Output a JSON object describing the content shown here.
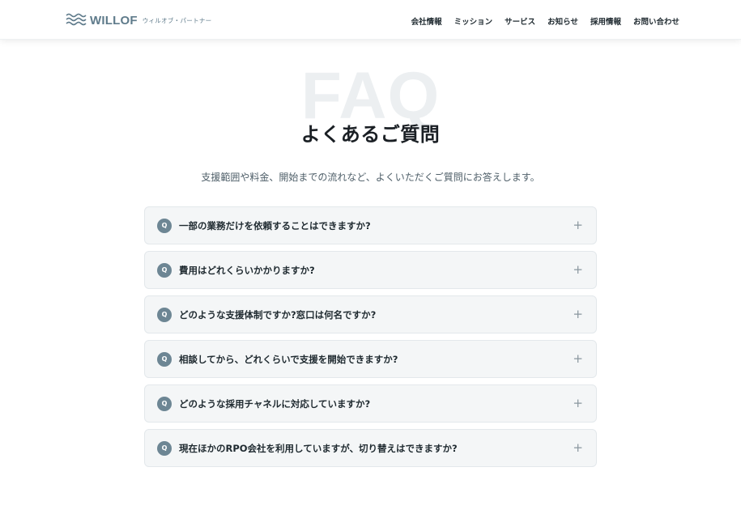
{
  "header": {
    "logo_name": "WILLOF",
    "logo_sub": "ウィルオブ・パートナー",
    "nav": [
      "会社情報",
      "ミッション",
      "サービス",
      "お知らせ",
      "採用情報",
      "お問い合わせ"
    ]
  },
  "hero": {
    "watermark": "FAQ",
    "title": "よくあるご質問",
    "subtitle": "支援範囲や料金、開始までの流れなど、よくいただくご質問にお答えします。"
  },
  "faq": {
    "badge": "Q",
    "expand_icon": "plus-icon",
    "questions": [
      "一部の業務だけを依頼することはできますか?",
      "費用はどれくらいかかりますか?",
      "どのような支援体制ですか?窓口は何名ですか?",
      "相談してから、どれくらいで支援を開始できますか?",
      "どのような採用チャネルに対応していますか?",
      "現在ほかのRPO会社を利用していますが、切り替えはできますか?"
    ]
  },
  "colors": {
    "accent": "#6d8694",
    "logo": "#5f7b8b",
    "card_bg": "#f4f6f7",
    "watermark": "#eceff1"
  }
}
